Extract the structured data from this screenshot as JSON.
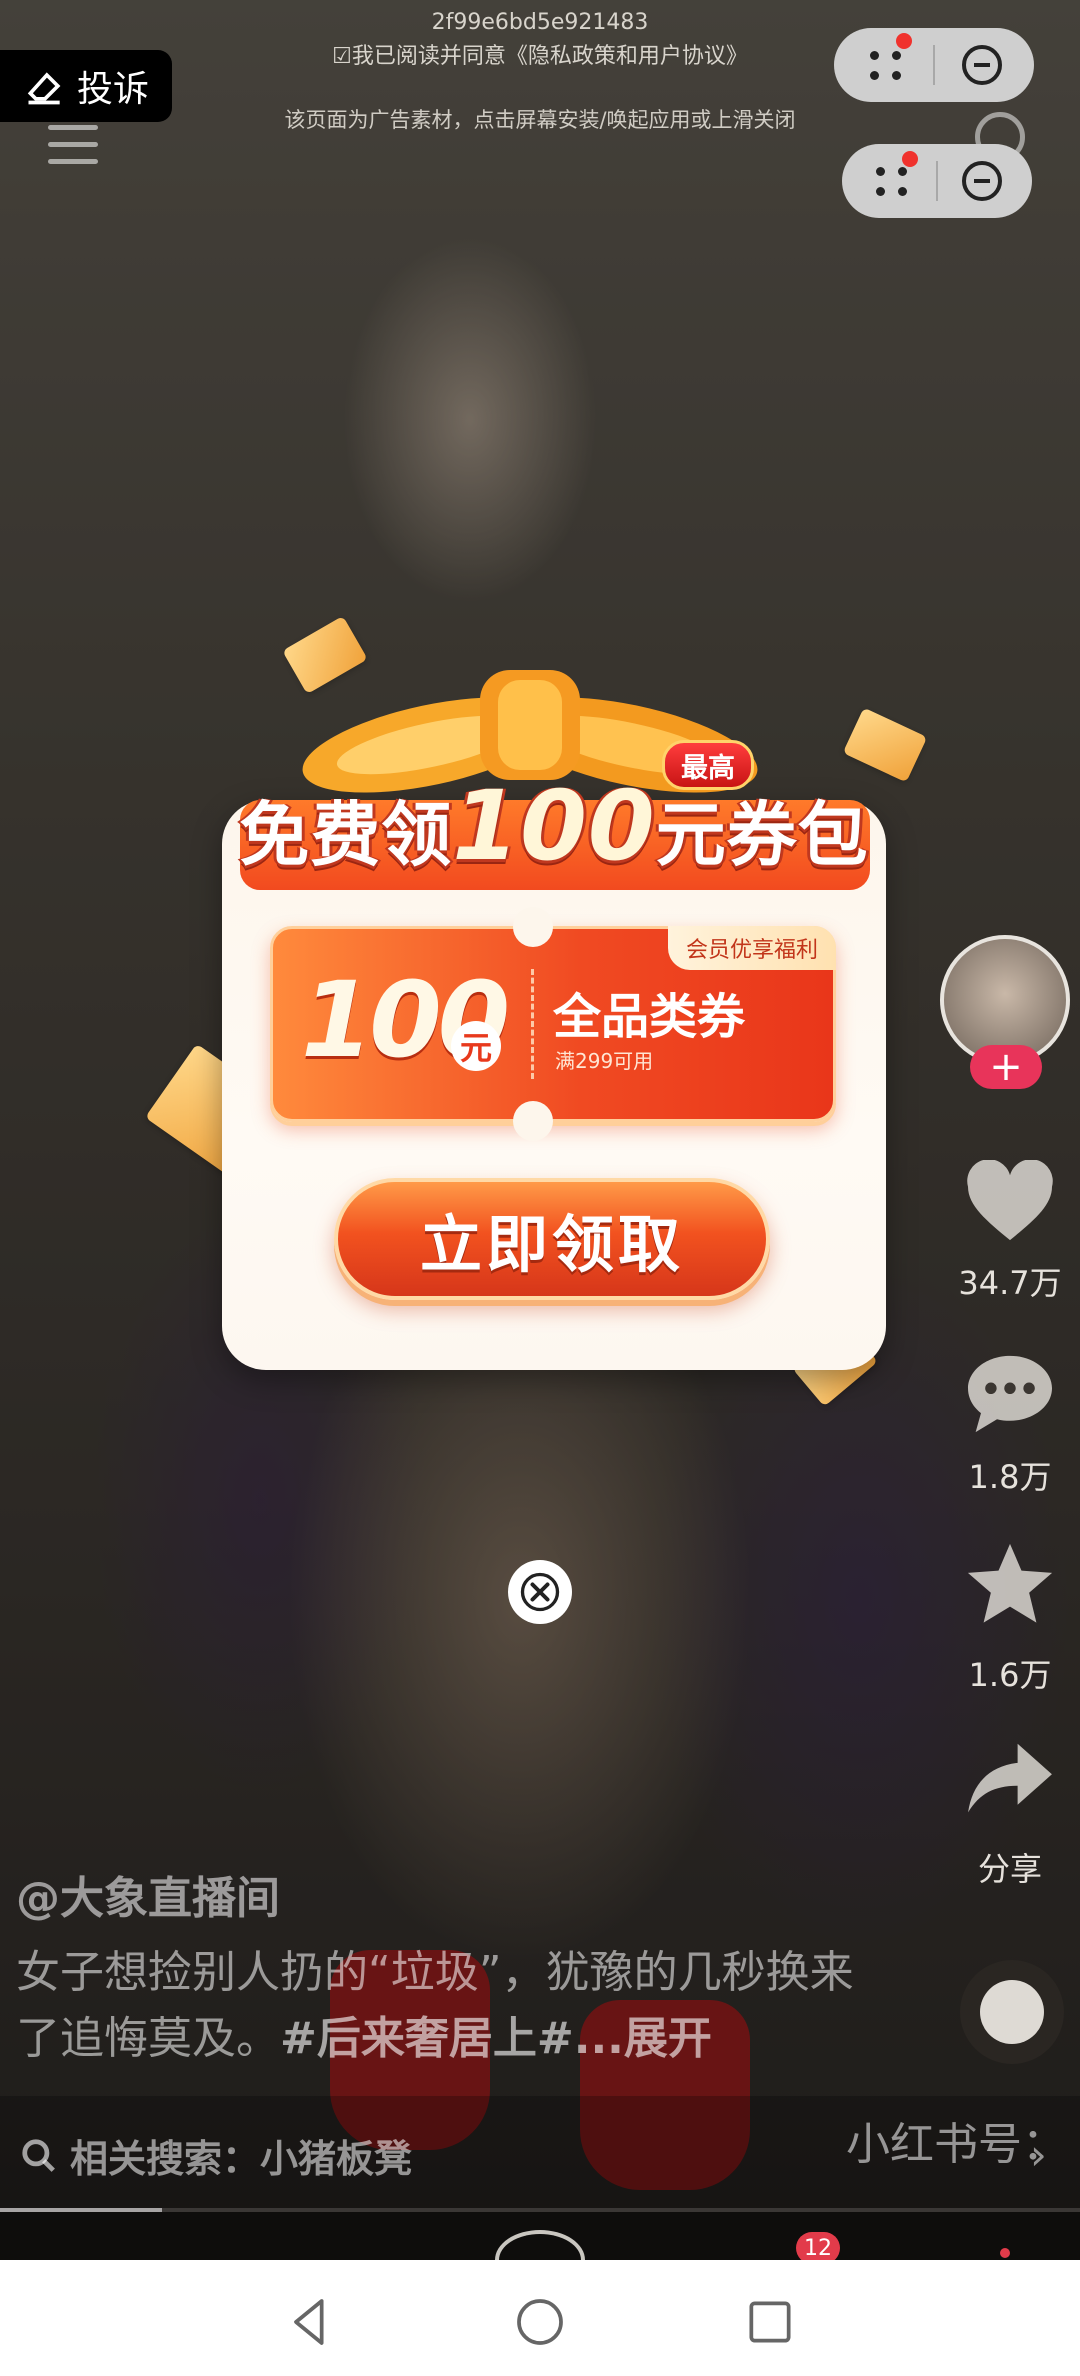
{
  "overlay": {
    "complain_label": "投诉",
    "ad_id": "2f99e6bd5e921483",
    "agree_text": "☑我已阅读并同意《隐私政策和用户协议》",
    "ad_note": "该页面为广告素材，点击屏幕安装/唤起应用或上滑关闭"
  },
  "popup": {
    "title_prefix": "免费领",
    "title_amount": "100",
    "title_suffix": "元券包",
    "max_badge": "最高",
    "coupon": {
      "amount": "100",
      "unit": "元",
      "label": "全品类券",
      "condition": "满299可用",
      "member_tag": "会员优享福利"
    },
    "claim_button": "立即领取"
  },
  "video": {
    "likes": "34.7万",
    "comments": "1.8万",
    "favorites": "1.6万",
    "share_label": "分享",
    "author": "@大象直播间",
    "description": "女子想捡别人扔的“垃圾”，犹豫的几秒换来了追悔莫及。",
    "hashtag": "#后来奢居上#...展开",
    "related_search": "相关搜索：小猪板凳",
    "side_tag": "小红书号：",
    "progress": 0.15
  },
  "tabbar": {
    "message_badge": "12"
  },
  "colors": {
    "accent_orange": "#f04a22",
    "follow_pink": "#e8345a",
    "popup_bg": "#fdf6ec"
  }
}
